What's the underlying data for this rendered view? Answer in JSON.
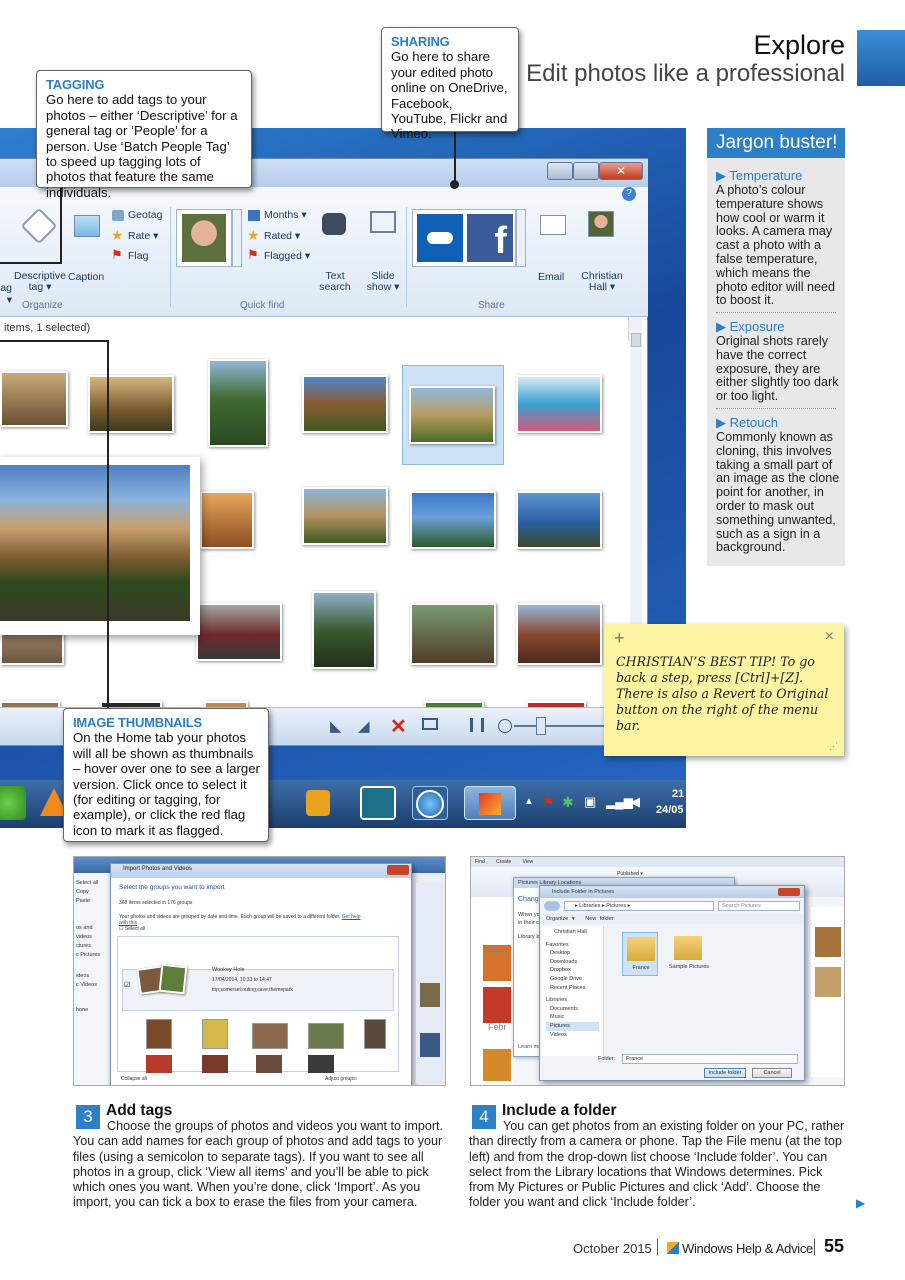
{
  "header": {
    "title": "Explore",
    "subtitle": "Edit photos like a professional"
  },
  "callouts": {
    "tagging": {
      "heading": "TAGGING",
      "text": "Go here to add tags to your photos – either ‘Descriptive’ for a general tag or ‘People’ for a person. Use ‘Batch People Tag’ to speed up tagging lots of photos that feature the same individuals."
    },
    "sharing": {
      "heading": "SHARING",
      "text": "Go here to share your edited photo online on OneDrive, Facebook, YouTube, Flickr and Vimeo."
    },
    "thumbnails": {
      "heading": "IMAGE THUMBNAILS",
      "text": "On the Home tab your photos will all be shown as thumbnails – hover over one to see a larger version. Click once to select it (for editing or tagging, for example), or click the red flag icon to mark it as flagged."
    }
  },
  "ribbon": {
    "descriptive_tag": "Descriptive tag ▾",
    "tag_partial": "ag ▾",
    "caption": "Caption",
    "geotag": "Geotag",
    "rate": "Rate ▾",
    "flag": "Flag",
    "months": "Months ▾",
    "rated": "Rated ▾",
    "flagged": "Flagged ▾",
    "text_search": "Text search",
    "slide_show": "Slide show ▾",
    "email": "Email",
    "person": "Christian Hall ▾",
    "groups": [
      "Organize",
      "Quick find",
      "Share"
    ],
    "help": "?"
  },
  "status": "items, 1 selected)",
  "taskbar": {
    "clock_time": "21",
    "clock_date": "24/05"
  },
  "jargon": {
    "title": "Jargon buster!",
    "terms": [
      {
        "term": "▶ Temperature",
        "def": "A photo’s colour temperature shows how cool or warm it looks. A camera may cast a photo with a false temperature, which means the photo editor will need to boost it."
      },
      {
        "term": "▶ Exposure",
        "def": "Original shots rarely have the correct exposure, they are either slightly too dark or too light."
      },
      {
        "term": "▶ Retouch",
        "def": "Commonly known as cloning, this involves taking a small part of an image as the clone point for another, in order to mask out something unwanted, such as a sign in a background."
      }
    ]
  },
  "tip": {
    "plus": "+",
    "close": "×",
    "text": "CHRISTIAN’S BEST TIP! To go back a step, press [Ctrl]+[Z]. There is also a Revert to Original button on the right of the menu bar."
  },
  "shot3": {
    "title": "Import Photos and Videos",
    "heading": "Select the groups you want to import",
    "count": "368 items selected in 176 groups",
    "info": "Your photos and videos are grouped by date and time. Each group will be saved to a different folder.",
    "help_link": "Get help with this",
    "select_all": "Select all",
    "group_name": "Wookey Hole",
    "group_date": "17/04/2014, 10:33 to 14:47",
    "group_tags": "trip;somerset;outing;cave;themepark",
    "left_items": [
      "Select all",
      "Copy",
      "Paste",
      "os and videos",
      "ctures",
      "c Pictures",
      "ideos",
      "c Videos",
      "hone"
    ],
    "collapse": "Collapse all",
    "adjust": "Adjust groups:"
  },
  "shot4": {
    "tabs": [
      "Find",
      "Create",
      "View"
    ],
    "dialog_title": "Include Folder in Pictures",
    "path": "▸ Libraries ▸ Pictures ▸",
    "search": "Search Pictures",
    "organize": "Organize ▾",
    "new_folder": "New folder",
    "nav": [
      "Christian Hall",
      "Favorites",
      "Desktop",
      "Downloads",
      "Dropbox",
      "Google Drive",
      "Recent Places",
      "Libraries",
      "Documents",
      "Music",
      "Pictures",
      "Videos"
    ],
    "folders": [
      "France",
      "Sample Pictures"
    ],
    "folder_label": "Folder:",
    "folder_value": "France",
    "include_btn": "Include folder",
    "cancel_btn": "Cancel",
    "behind_title": "Pictures Library Locations",
    "behind_texts": [
      "Chang",
      "When yo",
      "in their c",
      "Library lo",
      "Marc",
      "Febr",
      "Learn mo"
    ],
    "published": "Published ▾"
  },
  "steps": [
    {
      "num": "3",
      "title": "Add tags",
      "body": "Choose the groups of photos and videos you want to import. You can add names for each group of photos and add tags to your files (using a semicolon to separate tags). If you want to see all photos in a group, click ‘View all items’ and you’ll be able to pick which ones you want. When you’re done, click ‘Import’. As you import, you can tick a box to erase the files from your camera."
    },
    {
      "num": "4",
      "title": "Include a folder",
      "body": "You can get photos from an existing folder on your PC, rather than directly from a camera or phone. Tap the File menu (at the top left) and from the drop-down list choose ‘Include folder’. You can select from the Library locations that Windows determines. Pick from My Pictures or Public Pictures and click ‘Add’. Choose the folder you want and click ‘Include folder’."
    }
  ],
  "footer": {
    "date": "October 2015",
    "publication": "Windows Help & Advice",
    "page": "55",
    "next_arrow": "▶"
  }
}
